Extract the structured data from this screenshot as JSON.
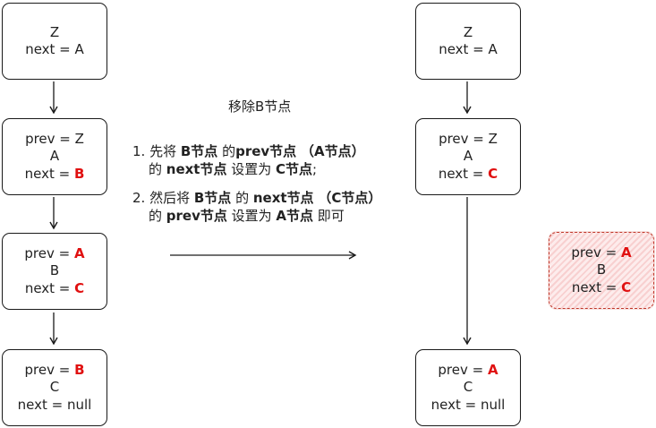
{
  "left_list": {
    "node_z": {
      "line1": "Z",
      "line2": "next = A"
    },
    "node_a": {
      "prev_label": "prev = ",
      "prev_value": "Z",
      "name": "A",
      "next_label": "next = ",
      "next_value": "B"
    },
    "node_b": {
      "prev_label": "prev = ",
      "prev_value": "A",
      "name": "B",
      "next_label": "next = ",
      "next_value": "C"
    },
    "node_c": {
      "prev_label": "prev = ",
      "prev_value": "B",
      "name": "C",
      "next_label": "next = null"
    }
  },
  "caption": "移除B节点",
  "steps": [
    {
      "num": "1. ",
      "t1": "先将 ",
      "b1": "B节点",
      "t2": " 的",
      "b2": "prev节点",
      "t3": " ",
      "b3": "（A节点）",
      "t4": "的 ",
      "b4": "next节点",
      "t5": " 设置为 ",
      "b5": "C节点",
      "t6": ";"
    },
    {
      "num": "2. ",
      "t1": "然后将 ",
      "b1": "B节点",
      "t2": " 的 ",
      "b2": "next节点",
      "t3": " ",
      "b3": "（C节点）",
      "t4": "的 ",
      "b4": "prev节点",
      "t5": " 设置为 ",
      "b5": "A节点",
      "t6": "  即可"
    }
  ],
  "right_list": {
    "node_z": {
      "line1": "Z",
      "line2": "next = A"
    },
    "node_a": {
      "prev_label": "prev = ",
      "prev_value": "Z",
      "name": "A",
      "next_label": "next = ",
      "next_value": "C"
    },
    "node_c": {
      "prev_label": "prev = ",
      "prev_value": "A",
      "name": "C",
      "next_label": "next = null"
    }
  },
  "removed_node": {
    "prev_label": "prev = ",
    "prev_value": "A",
    "name": "B",
    "next_label": "next = ",
    "next_value": "C"
  },
  "colors": {
    "highlight": "#e01010",
    "stroke": "#1a1a1a",
    "removed_border": "#c0392b",
    "removed_fill": "#f8d0d0"
  }
}
